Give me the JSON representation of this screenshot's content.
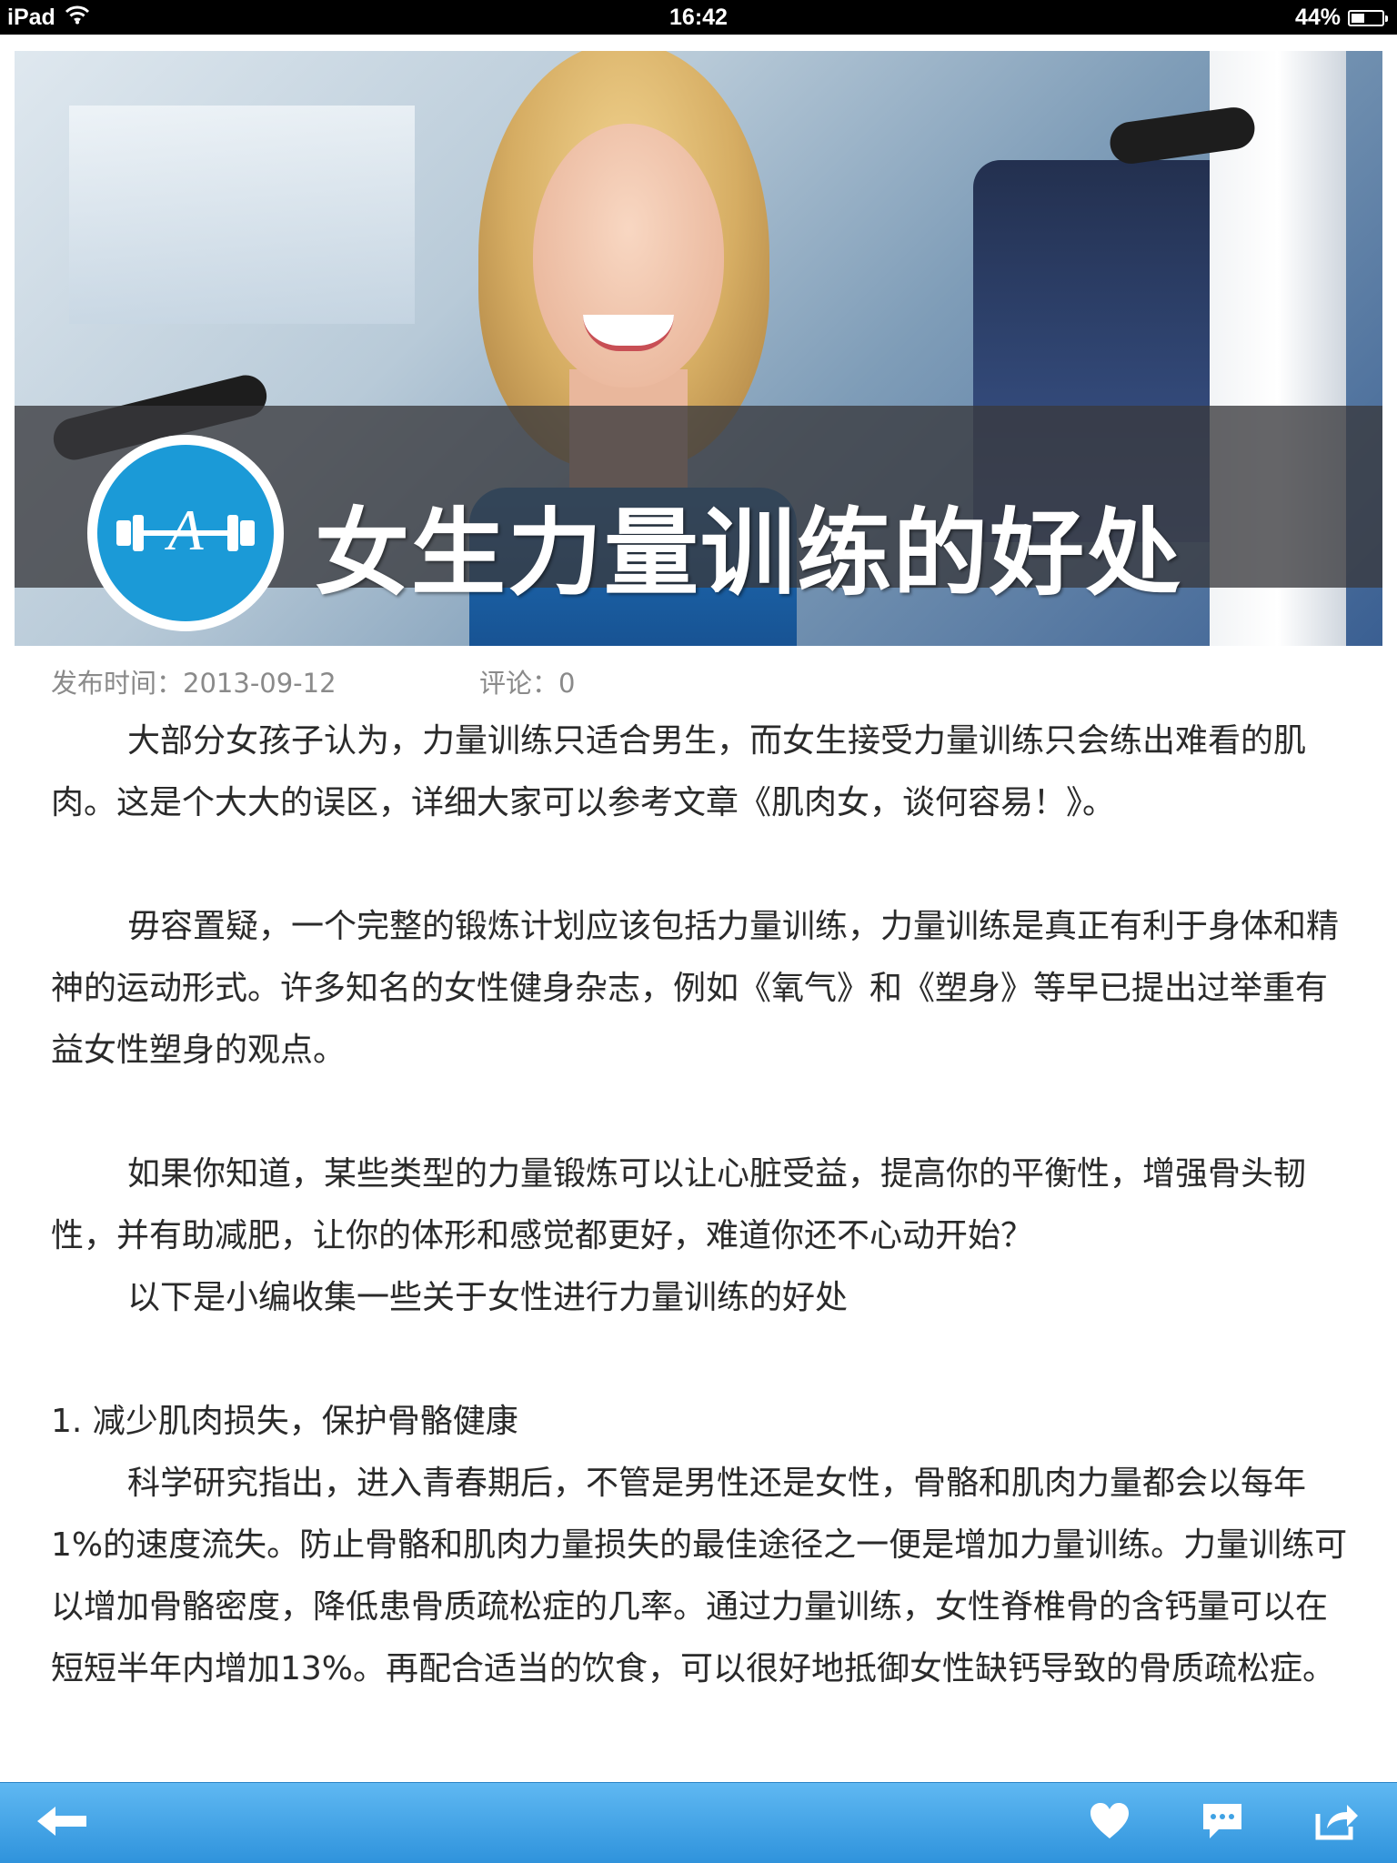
{
  "status_bar": {
    "device": "iPad",
    "time": "16:42",
    "battery": "44%",
    "battery_level": 0.44
  },
  "hero": {
    "title": "女生力量训练的好处",
    "logo_letter": "A"
  },
  "meta": {
    "publish_label": "发布时间：",
    "publish_date": "2013-09-12",
    "comments_label": "评论：",
    "comments_count": "0"
  },
  "article": {
    "paragraph_1": "大部分女孩子认为，力量训练只适合男生，而女生接受力量训练只会练出难看的肌肉。这是个大大的误区，详细大家可以参考文章《肌肉女，谈何容易！》。",
    "paragraph_2": "毋容置疑，一个完整的锻炼计划应该包括力量训练，力量训练是真正有利于身体和精神的运动形式。许多知名的女性健身杂志，例如《氧气》和《塑身》等早已提出过举重有益女性塑身的观点。",
    "paragraph_3": "如果你知道，某些类型的力量锻炼可以让心脏受益，提高你的平衡性，增强骨头韧性，并有助减肥，让你的体形和感觉都更好，难道你还不心动开始？",
    "paragraph_4": "以下是小编收集一些关于女性进行力量训练的好处",
    "heading_1": "1. 减少肌肉损失，保护骨骼健康",
    "paragraph_5": "科学研究指出，进入青春期后，不管是男性还是女性，骨骼和肌肉力量都会以每年 1%的速度流失。防止骨骼和肌肉力量损失的最佳途径之一便是增加力量训练。力量训练可以增加骨骼密度，降低患骨质疏松症的几率。通过力量训练，女性脊椎骨的含钙量可以在短短半年内增加13%。再配合适当的饮食，可以很好地抵御女性缺钙导致的骨质疏松症。"
  },
  "toolbar": {
    "back_icon": "back-arrow-icon",
    "like_icon": "heart-icon",
    "comment_icon": "comment-icon",
    "share_icon": "share-icon"
  },
  "colors": {
    "toolbar": "#3fa2e4",
    "logo_blue": "#1b9ad7",
    "meta_text": "#8a8a8a",
    "body_text": "#2a2a2a"
  }
}
